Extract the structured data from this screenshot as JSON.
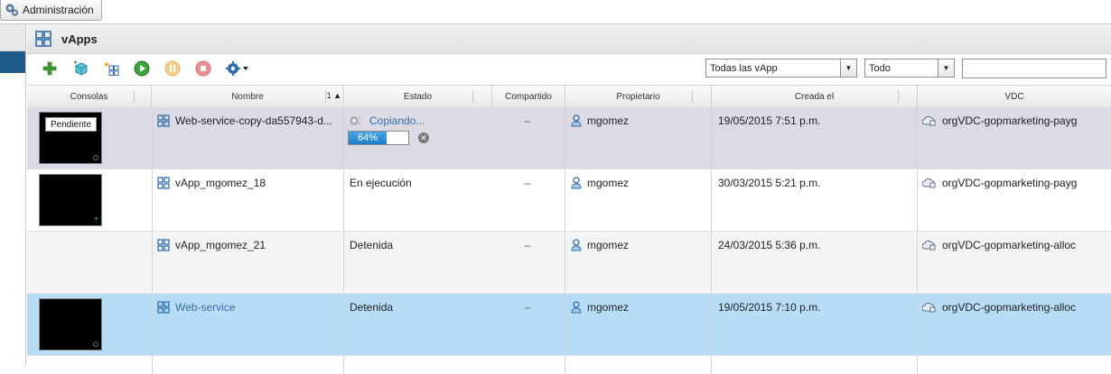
{
  "admin_tab": {
    "label": "Administración"
  },
  "panel": {
    "title": "vApps"
  },
  "toolbar": {
    "buttons": [
      {
        "icon": "add-icon"
      },
      {
        "icon": "vapp-template-icon"
      },
      {
        "icon": "build-vapp-icon"
      },
      {
        "icon": "play-icon"
      },
      {
        "icon": "pause-icon"
      },
      {
        "icon": "stop-icon"
      },
      {
        "icon": "gear-icon"
      }
    ],
    "filter_vapp": "Todas las vApp",
    "filter_scope": "Todo",
    "search_value": ""
  },
  "columns": {
    "consolas": "Consolas",
    "nombre": "Nombre",
    "sort": "1 ▲",
    "estado": "Estado",
    "compartido": "Compartido",
    "propietario": "Propietario",
    "creada": "Creada el",
    "vdc": "VDC"
  },
  "rows": [
    {
      "name": "Web-service-copy-da557943-d...",
      "status": "Copiando...",
      "progress": 0.64,
      "progress_text": "64%",
      "shared": "–",
      "owner": "mgomez",
      "created": "19/05/2015 7:51 p.m.",
      "vdc": "orgVDC-gopmarketing-payg",
      "console": "Pendiente"
    },
    {
      "name": "vApp_mgomez_18",
      "status": "En ejecución",
      "shared": "–",
      "owner": "mgomez",
      "created": "30/03/2015 5:21 p.m.",
      "vdc": "orgVDC-gopmarketing-payg"
    },
    {
      "name": "vApp_mgomez_21",
      "status": "Detenida",
      "shared": "–",
      "owner": "mgomez",
      "created": "24/03/2015 5:36 p.m.",
      "vdc": "orgVDC-gopmarketing-alloc"
    },
    {
      "name": "Web-service",
      "status": "Detenida",
      "shared": "–",
      "owner": "mgomez",
      "created": "19/05/2015 7:10 p.m.",
      "vdc": "orgVDC-gopmarketing-alloc"
    }
  ],
  "colors": {
    "selected_row": "#b7dcf6",
    "link": "#3a6ea5",
    "progress": "#1c7cc8"
  }
}
